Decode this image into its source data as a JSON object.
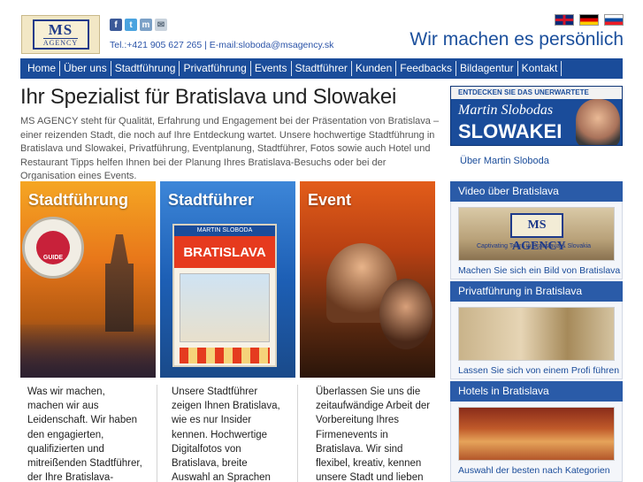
{
  "header": {
    "logo_top": "MS",
    "logo_bottom": "AGENCY",
    "contact": "Tel.:+421 905 627 265 | E-mail:sloboda@msagency.sk",
    "slogan": "Wir machen es persönlich",
    "social_icons": [
      "facebook-icon",
      "twitter-icon",
      "myspace-icon",
      "mail-icon"
    ],
    "languages": [
      "English",
      "Deutsch",
      "Slovensky"
    ]
  },
  "nav": {
    "items": [
      "Home",
      "Über uns",
      "Stadtführung",
      "Privatführung",
      "Events",
      "Stadtführer",
      "Kunden",
      "Feedbacks",
      "Bildagentur",
      "Kontakt"
    ]
  },
  "main": {
    "title": "Ihr Spezialist für Bratislava und Slowakei",
    "intro": "MS AGENCY steht für Qualität, Erfahrung und Engagement bei der Präsentation von Bratislava – einer reizenden Stadt, die noch auf Ihre Entdeckung wartet. Unsere hochwertige Stadtführung in Bratislava und Slowakei, Privatführung, Eventplanung, Stadtführer, Fotos sowie auch Hotel und Restaurant Tipps helfen Ihnen bei der Planung Ihres Bratislava-Besuchs oder bei der Organisation eines Events.",
    "tiles": [
      {
        "title": "Stadtführung",
        "seal_text": "GUIDE",
        "text": "Was wir machen, machen wir aus Leidenschaft. Wir haben den engagierten, qualifizierten und mitreißenden Stadtführer, der Ihre Bratislava-Führung zum Erlebnis"
      },
      {
        "title": "Stadtführer",
        "book_top": "MARTIN SLOBODA",
        "book_title": "BRATISLAVA",
        "text": "Unsere Stadtführer zeigen Ihnen Bratislava, wie es nur Insider kennen. Hochwertige Digitalfotos von Bratislava, breite Auswahl an Sprachen und ideale Größe machen sie"
      },
      {
        "title": "Event",
        "text": "Überlassen Sie uns die zeitaufwändige Arbeit der Vorbereitung Ihres Firmenevents in Bratislava. Wir sind flexibel, kreativ, kennen unsere Stadt und lieben"
      }
    ]
  },
  "sidebar": {
    "promo": {
      "top": "ENTDECKEN SIE DAS UNERWARTETE",
      "name": "Martin Slobodas",
      "big": "SLOWAKEI",
      "link": "Über Martin Sloboda"
    },
    "boxes": [
      {
        "title": "Video über Bratislava",
        "image_logo": "MS AGENCY",
        "image_sub": "Captivating Tours in Bratislava & Slovakia",
        "caption": "Machen Sie sich ein Bild von Bratislava"
      },
      {
        "title": "Privatführung in Bratislava",
        "caption": "Lassen Sie sich von einem Profi führen"
      },
      {
        "title": "Hotels in Bratislava",
        "caption": "Auswahl der besten nach Kategorien"
      }
    ]
  }
}
